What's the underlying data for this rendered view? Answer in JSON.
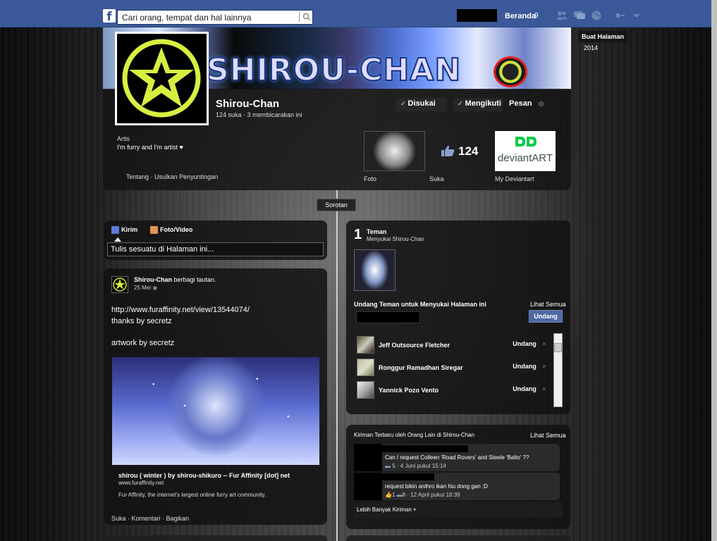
{
  "topbar": {
    "search_placeholder": "Cari orang, tempat dan hal lainnya",
    "home_label": "Beranda",
    "home_count": "9"
  },
  "cover": {
    "title_art": "SHIROU-CHAN"
  },
  "profile": {
    "name": "Shirou-Chan",
    "stats": "124 suka · 3 membicarakan ini",
    "liked_label": "Disukai",
    "follow_label": "Mengikuti",
    "message_label": "Pesan",
    "category": "Artis",
    "description": "I'm furry and I'm artist ♥",
    "about_link": "Tentang",
    "suggest_link": "Usulkan Penyuntingan",
    "about_separator": "·",
    "photo_label": "Foto",
    "likes_label": "Suka",
    "likes_count": "124",
    "app_label": "My Deviantart",
    "deviantart_text": "deviantART"
  },
  "side": {
    "create_page": "Buat Halaman",
    "year": "2014"
  },
  "timeline": {
    "highlight_label": "Sorotan"
  },
  "composer": {
    "post_tab": "Kirim",
    "photo_tab": "Foto/Video",
    "placeholder": "Tulis sesuatu di Halaman ini..."
  },
  "post": {
    "author": "Shirou-Chan",
    "action": "berbagi tautan.",
    "date": "25 Mei",
    "line1": "http://www.furaffinity.net/view/13544074/",
    "line2": "thanks by secretz",
    "line3": "artwork by secretz",
    "link_title": "shirou ( winter ) by shirou-shikuro -- Fur Affinity [dot] net",
    "link_domain": "www.furaffinity.net",
    "link_desc": "Fur Affinity, the internet's largest online furry art community.",
    "actions": "Suka · Komentari · Bagikan"
  },
  "friends": {
    "count": "1",
    "title": "Teman",
    "subtitle": "Menyukai Shirou-Chan",
    "invite_title": "Undang Teman untuk Menyukai Halaman ini",
    "see_all": "Lihat Semua",
    "invite_button": "Undang",
    "list": [
      {
        "name": "Jeff Outsource Fletcher",
        "invite": "Undang",
        "remove": "×"
      },
      {
        "name": "Ronggur Ramadhan Siregar",
        "invite": "Undang",
        "remove": "×"
      },
      {
        "name": "Yannick Pozo Vento",
        "invite": "Undang",
        "remove": "×"
      }
    ]
  },
  "recent": {
    "title": "Kiriman Terbaru oleh Orang Lain di Shirou-Chan",
    "see_all": "Lihat Semua",
    "posts": [
      {
        "text": "Can I request Colleen 'Road Rovers' and Steele 'Balto' ??",
        "comments": "5",
        "time": "4 Juni pukul 15:14"
      },
      {
        "text": "request bikin anthro ikan hiu dong gan :D",
        "likes": "1",
        "comments": "8",
        "time": "12 April pukul 18:39"
      }
    ],
    "more": "Lebih Banyak Kiriman"
  },
  "colors": {
    "fb_blue": "#3b5998",
    "invite_blue": "#4f6aa3",
    "avatar_yellow": "#d8ef40"
  }
}
